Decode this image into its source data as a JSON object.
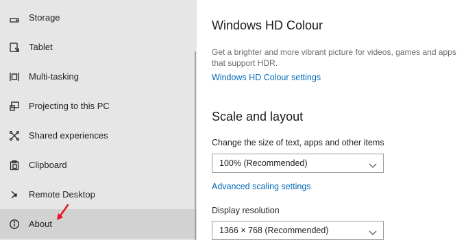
{
  "sidebar": {
    "items": [
      {
        "label": "Storage",
        "icon": "storage-icon"
      },
      {
        "label": "Tablet",
        "icon": "tablet-icon"
      },
      {
        "label": "Multi-tasking",
        "icon": "multitasking-icon"
      },
      {
        "label": "Projecting to this PC",
        "icon": "projecting-icon"
      },
      {
        "label": "Shared experiences",
        "icon": "shared-experiences-icon"
      },
      {
        "label": "Clipboard",
        "icon": "clipboard-icon"
      },
      {
        "label": "Remote Desktop",
        "icon": "remote-desktop-icon"
      },
      {
        "label": "About",
        "icon": "info-icon",
        "selected": true
      }
    ]
  },
  "hd_colour": {
    "title": "Windows HD Colour",
    "description": "Get a brighter and more vibrant picture for videos, games and apps that support HDR.",
    "settings_link": "Windows HD Colour settings"
  },
  "scale_layout": {
    "title": "Scale and layout",
    "size_label": "Change the size of text, apps and other items",
    "size_value": "100% (Recommended)",
    "advanced_link": "Advanced scaling settings",
    "resolution_label": "Display resolution",
    "resolution_value": "1366 × 768 (Recommended)"
  },
  "colors": {
    "sidebar_bg": "#e6e6e6",
    "selected_bg": "#d2d2d2",
    "link": "#0067b8",
    "annotation_arrow": "#e81123"
  }
}
